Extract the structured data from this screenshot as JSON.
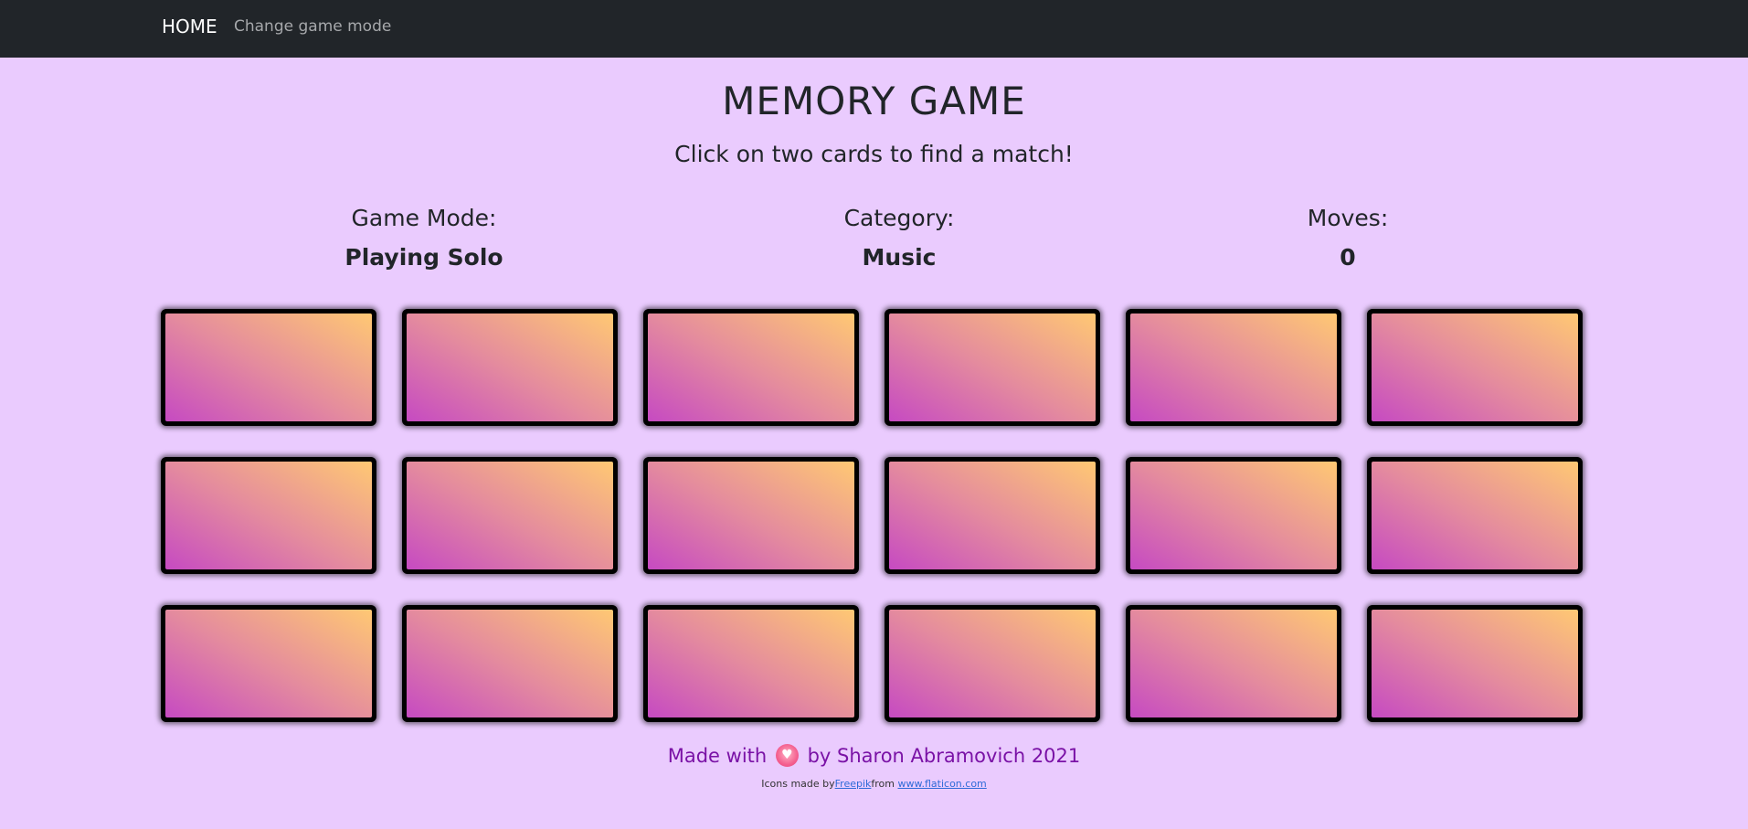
{
  "nav": {
    "home": "HOME",
    "change_mode": "Change game mode"
  },
  "header": {
    "title": "MEMORY GAME",
    "subtitle": "Click on two cards to find a match!"
  },
  "stats": {
    "mode_label": "Game Mode:",
    "mode_value": "Playing Solo",
    "category_label": "Category:",
    "category_value": "Music",
    "moves_label": "Moves:",
    "moves_value": "0"
  },
  "board": {
    "rows": 3,
    "columns": 6,
    "card_face_colors": [
      "#c64ac2",
      "#e48b9e",
      "#ffc873"
    ]
  },
  "footer": {
    "made_with": "Made with",
    "heart_icon": "heart-icon",
    "by": "by Sharon Abramovich 2021",
    "icons_made_by": "Icons made by",
    "freepik": "Freepik",
    "from": "from",
    "flaticon": "www.flaticon.com"
  }
}
